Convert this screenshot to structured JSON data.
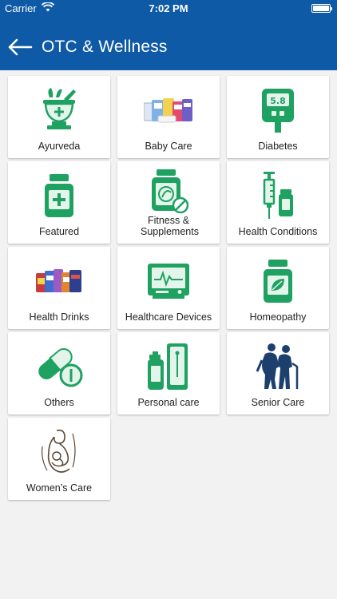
{
  "status_bar": {
    "carrier": "Carrier",
    "time": "7:02 PM"
  },
  "header": {
    "title": "OTC & Wellness"
  },
  "categories": [
    {
      "label": "Ayurveda",
      "icon": "mortar-pestle-icon"
    },
    {
      "label": "Baby Care",
      "icon": "baby-products-icon"
    },
    {
      "label": "Diabetes",
      "icon": "glucometer-icon",
      "reading": "5.8"
    },
    {
      "label": "Featured",
      "icon": "medicine-bottle-icon"
    },
    {
      "label": "Fitness & Supplements",
      "icon": "supplement-jar-icon"
    },
    {
      "label": "Health Conditions",
      "icon": "syringe-vial-icon"
    },
    {
      "label": "Health Drinks",
      "icon": "health-drinks-products-icon"
    },
    {
      "label": "Healthcare Devices",
      "icon": "monitor-device-icon"
    },
    {
      "label": "Homeopathy",
      "icon": "leaf-bottle-icon"
    },
    {
      "label": "Others",
      "icon": "capsule-pill-icon"
    },
    {
      "label": "Personal care",
      "icon": "spray-bottles-icon"
    },
    {
      "label": "Senior Care",
      "icon": "elderly-couple-icon"
    },
    {
      "label": "Women’s Care",
      "icon": "mother-child-icon"
    }
  ],
  "colors": {
    "header": "#0e5aa7",
    "icon_green": "#1fa162",
    "icon_light": "#e3f4ea",
    "background": "#f2f2f2",
    "senior": "#1c3f6e"
  }
}
